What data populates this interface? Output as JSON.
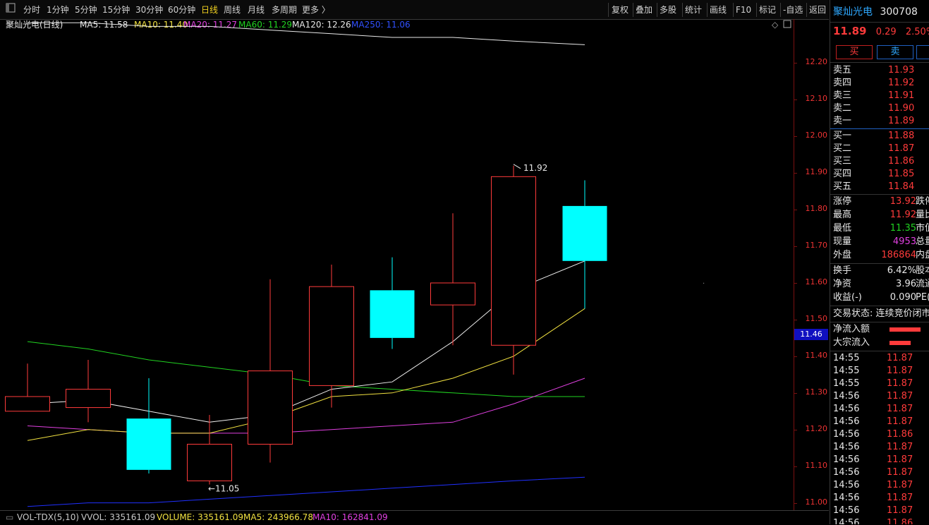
{
  "toolbar": {
    "left": [
      "分时",
      "1分钟",
      "5分钟",
      "15分钟",
      "30分钟",
      "60分钟",
      "日线",
      "周线",
      "月线",
      "多周期",
      "更多 〉"
    ],
    "active_index": 6,
    "right": [
      "复权",
      "叠加",
      "多股",
      "统计",
      "画线",
      "F10",
      "标记",
      "-自选",
      "返回"
    ]
  },
  "legend": {
    "name": "聚灿光电(日线)",
    "items": [
      {
        "text": "MA5: 11.58",
        "color": "#e8e8e8"
      },
      {
        "text": "MA10: 11.40",
        "color": "#f0e040"
      },
      {
        "text": "MA20: 11.27",
        "color": "#e040e0"
      },
      {
        "text": "MA60: 11.29",
        "color": "#21d321"
      },
      {
        "text": "MA120: 12.26",
        "color": "#e8e8e8"
      },
      {
        "text": "MA250: 11.06",
        "color": "#3050ff"
      }
    ]
  },
  "chart_data": {
    "type": "candlestick",
    "ylim": [
      10.98,
      12.32
    ],
    "yticks": [
      "12.20",
      "12.10",
      "12.00",
      "11.90",
      "11.80",
      "11.70",
      "11.60",
      "11.50",
      "11.40",
      "11.30",
      "11.20",
      "11.10",
      "11.00"
    ],
    "candles": [
      {
        "open": 11.25,
        "close": 11.29,
        "high": 11.38,
        "low": 11.25
      },
      {
        "open": 11.26,
        "close": 11.31,
        "high": 11.39,
        "low": 11.22
      },
      {
        "open": 11.23,
        "close": 11.09,
        "high": 11.34,
        "low": 11.08
      },
      {
        "open": 11.06,
        "close": 11.16,
        "high": 11.24,
        "low": 11.05
      },
      {
        "open": 11.16,
        "close": 11.36,
        "high": 11.61,
        "low": 11.11
      },
      {
        "open": 11.32,
        "close": 11.59,
        "high": 11.65,
        "low": 11.26
      },
      {
        "open": 11.58,
        "close": 11.45,
        "high": 11.67,
        "low": 11.42
      },
      {
        "open": 11.54,
        "close": 11.6,
        "high": 11.79,
        "low": 11.43
      },
      {
        "open": 11.43,
        "close": 11.89,
        "high": 11.92,
        "low": 11.35
      },
      {
        "open": 11.81,
        "close": 11.66,
        "high": 11.88,
        "low": 11.53
      }
    ],
    "ma5": [
      11.27,
      11.28,
      11.25,
      11.22,
      11.24,
      11.31,
      11.33,
      11.44,
      11.58,
      11.66
    ],
    "ma10": [
      11.17,
      11.2,
      11.19,
      11.19,
      11.23,
      11.29,
      11.3,
      11.34,
      11.4,
      11.53
    ],
    "ma20": [
      11.21,
      11.2,
      11.19,
      11.19,
      11.19,
      11.2,
      11.21,
      11.22,
      11.27,
      11.34
    ],
    "ma60": [
      11.44,
      11.42,
      11.39,
      11.37,
      11.35,
      11.32,
      11.31,
      11.3,
      11.29,
      11.29
    ],
    "ma120": [
      12.31,
      12.31,
      12.3,
      12.3,
      12.29,
      12.28,
      12.27,
      12.27,
      12.26,
      12.25
    ],
    "ma250": [
      10.99,
      11.0,
      11.0,
      11.01,
      11.02,
      11.03,
      11.04,
      11.05,
      11.06,
      11.07
    ],
    "annotations": [
      {
        "text": "11.92",
        "candle": 8,
        "value": 11.92,
        "side": "high"
      },
      {
        "text": "←11.05",
        "candle": 3,
        "value": 11.05,
        "side": "low"
      }
    ],
    "current_price_tag": "11.46"
  },
  "volume_bar": {
    "items": [
      {
        "text": "VOL-TDX(5,10)",
        "color": "#c8c8c8"
      },
      {
        "text": "VVOL: 335161.09",
        "color": "#c8c8c8"
      },
      {
        "text": "VOLUME: 335161.09",
        "color": "#f0e040"
      },
      {
        "text": "MA5: 243966.78",
        "color": "#f0e040"
      },
      {
        "text": "MA10: 162841.09",
        "color": "#e040e0"
      }
    ]
  },
  "quote": {
    "name": "聚灿光电",
    "code": "300708",
    "price": "11.89",
    "change": "0.29",
    "change_pct": "2.50%",
    "buy_button": "买",
    "sell_button": "卖",
    "asks": [
      {
        "label": "卖五",
        "price": "11.93"
      },
      {
        "label": "卖四",
        "price": "11.92"
      },
      {
        "label": "卖三",
        "price": "11.91"
      },
      {
        "label": "卖二",
        "price": "11.90"
      },
      {
        "label": "卖一",
        "price": "11.89"
      }
    ],
    "bids": [
      {
        "label": "买一",
        "price": "11.88"
      },
      {
        "label": "买二",
        "price": "11.87"
      },
      {
        "label": "买三",
        "price": "11.86"
      },
      {
        "label": "买四",
        "price": "11.85"
      },
      {
        "label": "买五",
        "price": "11.84"
      }
    ],
    "stats": [
      {
        "label": "涨停",
        "value": "13.92",
        "color": "#ff3b3b",
        "label2": "跌停"
      },
      {
        "label": "最高",
        "value": "11.92",
        "color": "#ff3b3b",
        "label2": "量比"
      },
      {
        "label": "最低",
        "value": "11.35",
        "color": "#21d321",
        "label2": "市值"
      },
      {
        "label": "现量",
        "value": "4953",
        "color": "#e040e0",
        "label2": "总量"
      },
      {
        "label": "外盘",
        "value": "186864",
        "color": "#ff3b3b",
        "label2": "内盘"
      }
    ],
    "stats2": [
      {
        "label": "换手",
        "value": "6.42%",
        "label2": "股本"
      },
      {
        "label": "净资",
        "value": "3.96",
        "label2": "流通"
      },
      {
        "label": "收益(-)",
        "value": "0.090",
        "label2": "PE("
      }
    ],
    "trade_status": "交易状态: 连续竞价闭市",
    "flows": [
      {
        "label": "净流入额"
      },
      {
        "label": "大宗流入"
      }
    ],
    "ticks": [
      {
        "time": "14:55",
        "price": "11.87"
      },
      {
        "time": "14:55",
        "price": "11.87"
      },
      {
        "time": "14:55",
        "price": "11.87"
      },
      {
        "time": "14:56",
        "price": "11.87"
      },
      {
        "time": "14:56",
        "price": "11.87"
      },
      {
        "time": "14:56",
        "price": "11.87"
      },
      {
        "time": "14:56",
        "price": "11.86"
      },
      {
        "time": "14:56",
        "price": "11.87"
      },
      {
        "time": "14:56",
        "price": "11.87"
      },
      {
        "time": "14:56",
        "price": "11.87"
      },
      {
        "time": "14:56",
        "price": "11.87"
      },
      {
        "time": "14:56",
        "price": "11.87"
      },
      {
        "time": "14:56",
        "price": "11.87"
      },
      {
        "time": "14:56",
        "price": "11.86"
      }
    ]
  }
}
